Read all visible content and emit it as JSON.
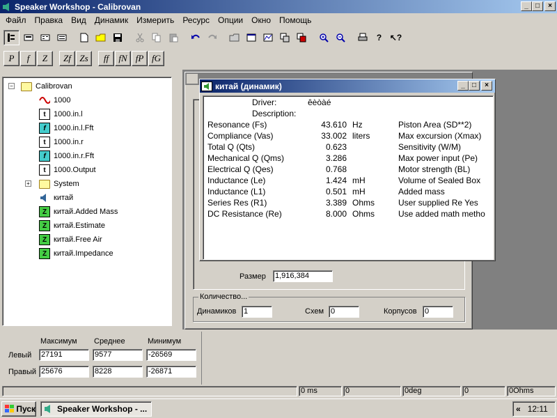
{
  "app": {
    "title": "Speaker Workshop - Calibrovan",
    "controls": {
      "minimize": "_",
      "maximize": "□",
      "close": "×"
    }
  },
  "menu": [
    "Файл",
    "Правка",
    "Вид",
    "Динамик",
    "Измерить",
    "Ресурс",
    "Опции",
    "Окно",
    "Помощь"
  ],
  "toolbar2": [
    "P",
    "f",
    "Z",
    "Zf",
    "Zs",
    "ff",
    "fN",
    "fP",
    "fG"
  ],
  "tree": {
    "items": [
      {
        "label": "Calibrovan",
        "icon": "folder-icon"
      },
      {
        "label": "1000",
        "icon": "sine-icon"
      },
      {
        "label": "1000.in.l",
        "icon": "t-doc-icon"
      },
      {
        "label": "1000.in.l.Fft",
        "icon": "f-doc-icon"
      },
      {
        "label": "1000.in.r",
        "icon": "t-doc-icon"
      },
      {
        "label": "1000.in.r.Fft",
        "icon": "f-doc-icon"
      },
      {
        "label": "1000.Output",
        "icon": "t-doc-icon"
      },
      {
        "label": "System",
        "icon": "folder-icon"
      },
      {
        "label": "китай",
        "icon": "speaker-icon"
      },
      {
        "label": "китай.Added Mass",
        "icon": "z-doc-icon"
      },
      {
        "label": "китай.Estimate",
        "icon": "z-doc-icon"
      },
      {
        "label": "китай.Free Air",
        "icon": "z-doc-icon"
      },
      {
        "label": "китай.Impedance",
        "icon": "z-doc-icon"
      }
    ],
    "doc_letters": {
      "t": "t",
      "f": "f",
      "z": "Z"
    }
  },
  "bg_window": {
    "size_label": "Размер",
    "size_value": "1,916,384",
    "count_group": "Количество...",
    "drivers_label": "Динамиков",
    "drivers_value": "1",
    "circuits_label": "Схем",
    "circuits_value": "0",
    "enclosures_label": "Корпусов",
    "enclosures_value": "0"
  },
  "dialog": {
    "title": "китай (динамик)",
    "driver_label": "Driver:",
    "driver_value": "êèòàé",
    "description_label": "Description:",
    "rows": [
      {
        "name": "Resonance (Fs)",
        "value": "43.610",
        "unit": "Hz",
        "right": "Piston Area (SD**2)"
      },
      {
        "name": "Compliance (Vas)",
        "value": "33.002",
        "unit": "liters",
        "right": "Max excursion (Xmax)"
      },
      {
        "name": "Total Q (Qts)",
        "value": "0.623",
        "unit": "",
        "right": "Sensitivity (W/M)"
      },
      {
        "name": "Mechanical Q (Qms)",
        "value": "3.286",
        "unit": "",
        "right": "Max power input (Pe)"
      },
      {
        "name": "Electrical Q (Qes)",
        "value": "0.768",
        "unit": "",
        "right": "Motor strength (BL)"
      },
      {
        "name": "Inductance (Le)",
        "value": "1.424",
        "unit": "mH",
        "right": "Volume of Sealed Box"
      },
      {
        "name": "Inductance (L1)",
        "value": "0.501",
        "unit": "mH",
        "right": "Added mass"
      },
      {
        "name": "Series Res (R1)",
        "value": "3.389",
        "unit": "Ohms",
        "right": "User supplied Re  Yes"
      },
      {
        "name": "DC Resistance (Re)",
        "value": "8.000",
        "unit": "Ohms",
        "right": "Use added math metho"
      }
    ]
  },
  "levels": {
    "headers": [
      "Максимум",
      "Среднее",
      "Минимум"
    ],
    "left_label": "Левый",
    "right_label": "Правый",
    "left": [
      "27191",
      "9577",
      "-26569"
    ],
    "right": [
      "25676",
      "8228",
      "-26871"
    ]
  },
  "status": [
    "0 ms",
    "0",
    "0deg",
    "0",
    "0Ohms"
  ],
  "taskbar": {
    "start": "Пуск",
    "task": "Speaker Workshop - ...",
    "chevron": "«",
    "clock": "12:11"
  }
}
